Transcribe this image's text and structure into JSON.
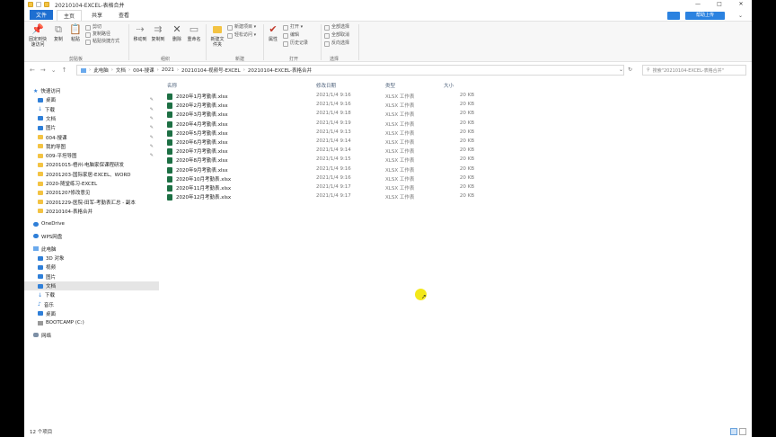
{
  "window": {
    "title": "20210104-EXCEL-表格合并",
    "controls": [
      "—",
      "□",
      "✕"
    ]
  },
  "tabs": [
    {
      "label": "文件",
      "kind": "file"
    },
    {
      "label": "主页",
      "kind": "active"
    },
    {
      "label": "共享",
      "kind": "normal"
    },
    {
      "label": "查看",
      "kind": "normal"
    }
  ],
  "help_badge": "帮助上传",
  "ribbon": {
    "pin_label": "固定到快速访问",
    "copy_label": "复制",
    "paste_label": "粘贴",
    "cut_label": "剪切",
    "copy_path_label": "复制路径",
    "paste_shortcut_label": "粘贴快捷方式",
    "move_to_label": "移动到",
    "copy_to_label": "复制到",
    "delete_label": "删除",
    "rename_label": "重命名",
    "new_folder_label": "新建文件夹",
    "new_item_label": "新建项目 ▾",
    "easy_access_label": "轻松访问 ▾",
    "properties_label": "属性",
    "open_label": "打开 ▾",
    "edit_label": "编辑",
    "history_label": "历史记录",
    "select_all_label": "全部选择",
    "select_none_label": "全部取消",
    "invert_selection_label": "反向选择",
    "groups": {
      "clipboard": "剪贴板",
      "organize": "组织",
      "new": "新建",
      "open": "打开",
      "select": "选择"
    }
  },
  "address": {
    "crumbs": [
      "此电脑",
      "文档",
      "004-搜课",
      "2021",
      "20210104-视频号-EXCEL",
      "20210104-EXCEL-表格合并"
    ],
    "refresh": "↻",
    "dropdown": "⌄",
    "search_placeholder": "搜索\"20210104-EXCEL-表格合并\""
  },
  "nav": {
    "back": "←",
    "forward": "→",
    "recent": "⌄",
    "up": "↑",
    "quick_access": "快速访问",
    "quick_items": [
      {
        "label": "桌面",
        "icon": "blue",
        "pinned": true
      },
      {
        "label": "下载",
        "icon": "down",
        "pinned": true
      },
      {
        "label": "文档",
        "icon": "blue",
        "pinned": true
      },
      {
        "label": "图片",
        "icon": "blue",
        "pinned": true
      },
      {
        "label": "004-搜课",
        "icon": "folder",
        "pinned": true
      },
      {
        "label": "我的导图",
        "icon": "folder",
        "pinned": true
      },
      {
        "label": "009-平坦导图",
        "icon": "folder",
        "pinned": true
      },
      {
        "label": "20201015-梧州-电脑家保课程研发",
        "icon": "folder",
        "pinned": false
      },
      {
        "label": "20201203-国际家居-EXCEL、WORD",
        "icon": "folder",
        "pinned": false
      },
      {
        "label": "2020-随堂练习-EXCEL",
        "icon": "folder",
        "pinned": false
      },
      {
        "label": "2020120?修改意见",
        "icon": "folder",
        "pinned": false
      },
      {
        "label": "20201229-医院-田军-考勤表汇总 - 副本",
        "icon": "folder",
        "pinned": false
      },
      {
        "label": "20210104-表格合并",
        "icon": "folder",
        "pinned": false
      }
    ],
    "onedrive": "OneDrive",
    "wps": "WPS网盘",
    "this_pc": "此电脑",
    "pc_items": [
      {
        "label": "3D 对象",
        "icon": "blue"
      },
      {
        "label": "视频",
        "icon": "blue"
      },
      {
        "label": "图片",
        "icon": "blue"
      },
      {
        "label": "文档",
        "icon": "blue",
        "selected": true
      },
      {
        "label": "下载",
        "icon": "down"
      },
      {
        "label": "音乐",
        "icon": "music"
      },
      {
        "label": "桌面",
        "icon": "blue"
      },
      {
        "label": "BOOTCAMP (C:)",
        "icon": "drive"
      }
    ],
    "network": "网络",
    "pin_glyph": "✎",
    "star_glyph": "★",
    "down_glyph": "↓",
    "music_glyph": "♪"
  },
  "columns": {
    "name": "名称",
    "date": "修改日期",
    "type": "类型",
    "size": "大小"
  },
  "files": [
    {
      "name": "2020年1月考勤表.xlsx",
      "date": "2021/1/4 9:16",
      "type": "XLSX 工作表",
      "size": "20 KB"
    },
    {
      "name": "2020年2月考勤表.xlsx",
      "date": "2021/1/4 9:16",
      "type": "XLSX 工作表",
      "size": "20 KB"
    },
    {
      "name": "2020年3月考勤表.xlsx",
      "date": "2021/1/4 9:18",
      "type": "XLSX 工作表",
      "size": "20 KB"
    },
    {
      "name": "2020年4月考勤表.xlsx",
      "date": "2021/1/4 9:19",
      "type": "XLSX 工作表",
      "size": "20 KB"
    },
    {
      "name": "2020年5月考勤表.xlsx",
      "date": "2021/1/4 9:13",
      "type": "XLSX 工作表",
      "size": "20 KB"
    },
    {
      "name": "2020年6月考勤表.xlsx",
      "date": "2021/1/4 9:14",
      "type": "XLSX 工作表",
      "size": "20 KB"
    },
    {
      "name": "2020年7月考勤表.xlsx",
      "date": "2021/1/4 9:14",
      "type": "XLSX 工作表",
      "size": "20 KB"
    },
    {
      "name": "2020年8月考勤表.xlsx",
      "date": "2021/1/4 9:15",
      "type": "XLSX 工作表",
      "size": "20 KB"
    },
    {
      "name": "2020年9月考勤表.xlsx",
      "date": "2021/1/4 9:16",
      "type": "XLSX 工作表",
      "size": "20 KB"
    },
    {
      "name": "2020年10月考勤表.xlsx",
      "date": "2021/1/4 9:16",
      "type": "XLSX 工作表",
      "size": "20 KB"
    },
    {
      "name": "2020年11月考勤表.xlsx",
      "date": "2021/1/4 9:17",
      "type": "XLSX 工作表",
      "size": "20 KB"
    },
    {
      "name": "2020年12月考勤表.xlsx",
      "date": "2021/1/4 9:17",
      "type": "XLSX 工作表",
      "size": "20 KB"
    }
  ],
  "status": {
    "count": "12 个项目"
  },
  "colors": {
    "accent": "#1e6fd1",
    "excel": "#1d7044",
    "folder": "#f3c343",
    "cursor_highlight": "#f3e81a"
  }
}
